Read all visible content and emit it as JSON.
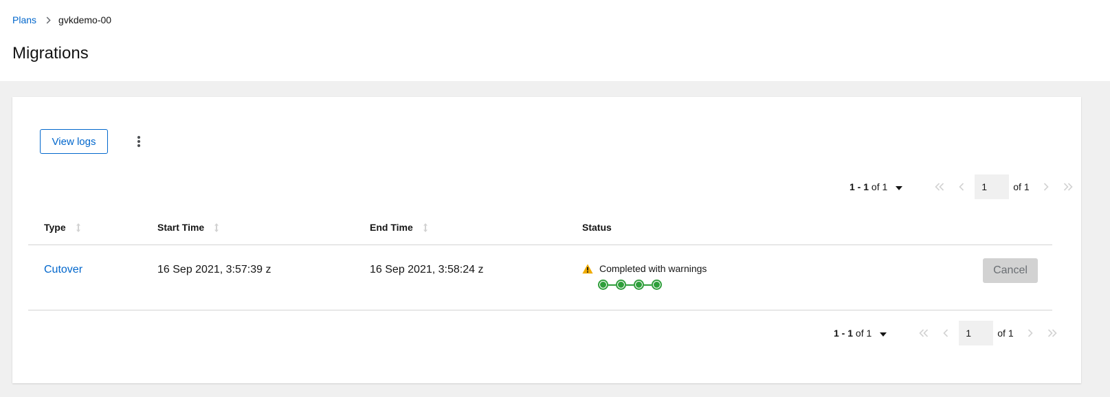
{
  "breadcrumb": {
    "parent": "Plans",
    "current": "gvkdemo-00"
  },
  "page_title": "Migrations",
  "toolbar": {
    "view_logs_label": "View logs"
  },
  "pagination_top": {
    "range_start_end": "1 - 1",
    "of_total": "of 1",
    "page": "1",
    "of_pages": "of 1"
  },
  "pagination_bottom": {
    "range_start_end": "1 - 1",
    "of_total": "of 1",
    "page": "1",
    "of_pages": "of 1"
  },
  "table": {
    "columns": [
      "Type",
      "Start Time",
      "End Time",
      "Status"
    ],
    "rows": [
      {
        "type": "Cutover",
        "start_time": "16 Sep 2021, 3:57:39 z",
        "end_time": "16 Sep 2021, 3:58:24 z",
        "status": "Completed with warnings",
        "pipeline_steps_completed": 4,
        "pipeline_steps_total": 4,
        "action_label": "Cancel"
      }
    ]
  },
  "colors": {
    "link": "#0066cc",
    "success": "#2e9e3a",
    "warning": "#f0ab00",
    "disabled_bg": "#d2d2d2"
  }
}
